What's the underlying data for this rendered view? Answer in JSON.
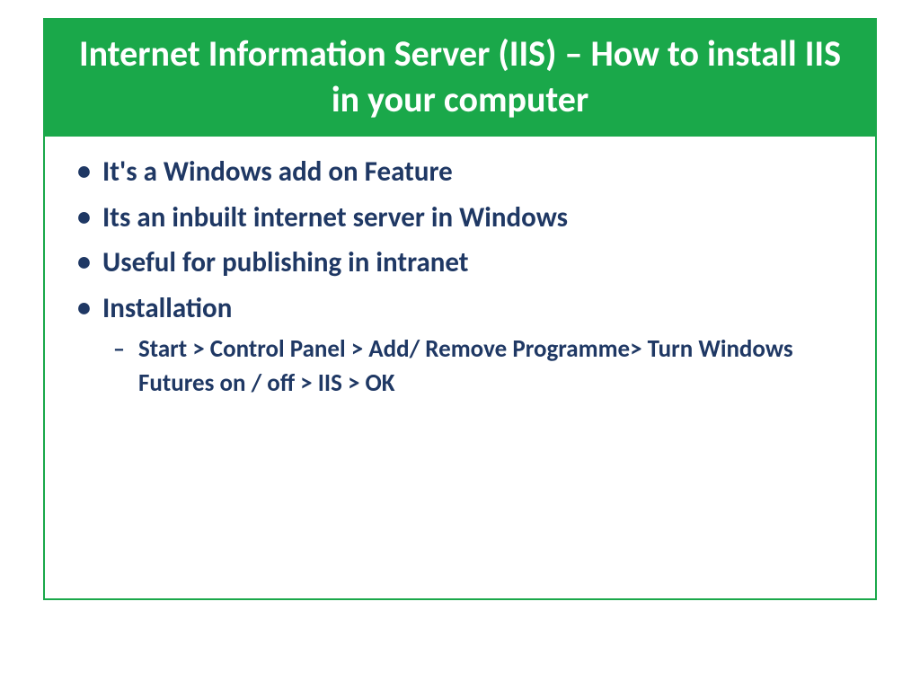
{
  "slide": {
    "title": "Internet Information Server (IIS) – How to install IIS in your computer",
    "bullets": [
      "It's a Windows add on Feature",
      "Its an inbuilt internet server in Windows",
      "Useful for publishing in intranet",
      "Installation"
    ],
    "subBullets": [
      "Start > Control Panel > Add/ Remove Programme> Turn Windows Futures on / off > IIS > OK"
    ]
  },
  "colors": {
    "titleBg": "#1aa84a",
    "titleText": "#ffffff",
    "bodyText": "#1f3864",
    "border": "#1aa84a"
  }
}
